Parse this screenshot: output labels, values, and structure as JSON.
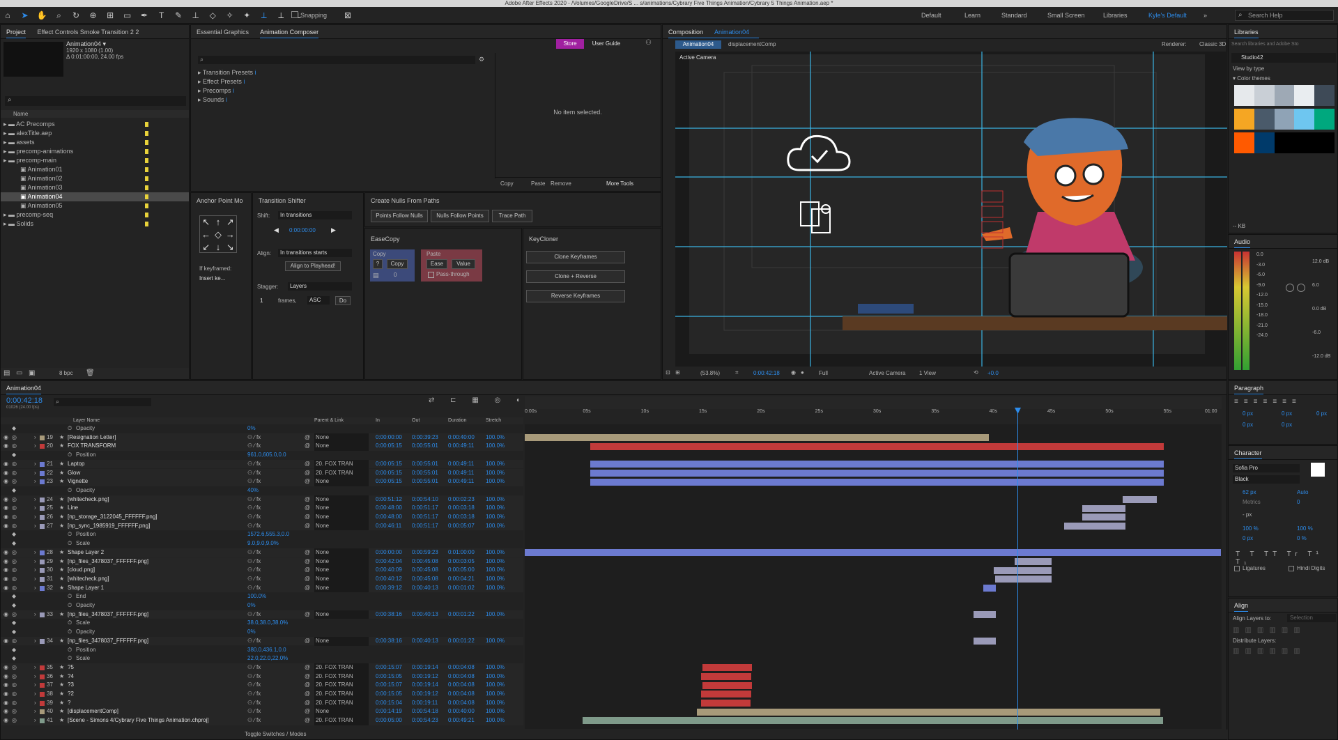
{
  "titlebar": {
    "text": "Adobe After Effects 2020 - /Volumes/GoogleDrive/S ... s/animations/Cybrary Five Things Animation/Cybrary 5 Things Animation.aep *"
  },
  "toolbar": {
    "snapping": "Snapping",
    "workspaces": [
      "Default",
      "Learn",
      "Standard",
      "Small Screen",
      "Libraries",
      "Kyle's Default"
    ],
    "search_help": "Search Help"
  },
  "project": {
    "tabs": [
      "Project",
      "Effect Controls Smoke Transition 2 2"
    ],
    "comp_name": "Animation04 ▾",
    "comp_info": [
      "1920 x 1080 (1.00)",
      "Δ 0:01:00:00, 24.00 fps"
    ],
    "column": "Name",
    "items": [
      "AC Precomps",
      "alexTitle.aep",
      "assets",
      "precomp-animations",
      "precomp-main",
      "Animation01",
      "Animation02",
      "Animation03",
      "Animation04",
      "Animation05",
      "precomp-seq",
      "Solids"
    ],
    "bpc": "8 bpc"
  },
  "composer": {
    "tabs": [
      "Essential Graphics",
      "Animation Composer"
    ],
    "store": "Store",
    "user_guide": "User Guide",
    "tree": [
      "Transition Presets",
      "Effect Presets",
      "Precomps",
      "Sounds"
    ],
    "no_item": "No item selected.",
    "copy": "Copy",
    "paste": "Paste",
    "remove": "Remove",
    "more_tools": "More Tools"
  },
  "anchor": {
    "title": "Anchor Point Mo",
    "if_keyframed": "If keyframed:",
    "insert": "Insert ke..."
  },
  "shifter": {
    "title": "Transition Shifter",
    "shift_label": "Shift:",
    "shift_value": "In transitions",
    "time": "0:00:00:00",
    "align_label": "Align:",
    "align_value": "In transitions starts",
    "align_btn": "Align to Playhead!",
    "stagger_label": "Stagger:",
    "stagger_value": "Layers",
    "frames_num": "1",
    "frames": "frames,",
    "asc": "ASC",
    "do": "Do"
  },
  "nulls": {
    "title": "Create Nulls From Paths",
    "buttons": [
      "Points Follow Nulls",
      "Nulls Follow Points",
      "Trace Path"
    ]
  },
  "easecopy": {
    "title": "EaseCopy",
    "copy_label": "Copy",
    "copy_btn": "Copy",
    "copy_num": "0",
    "paste_label": "Paste",
    "ease": "Ease",
    "value": "Value",
    "passthrough": "Pass-through"
  },
  "keycloner": {
    "title": "KeyCloner",
    "buttons": [
      "Clone Keyframes",
      "Clone + Reverse",
      "Reverse Keyframes"
    ]
  },
  "composition": {
    "tab": "Composition",
    "tab_name": "Animation04",
    "crumbs": [
      "Animation04",
      "displacementComp"
    ],
    "renderer": "Renderer:",
    "renderer_val": "Classic 3D",
    "camera": "Active Camera",
    "footer": {
      "zoom": "(53.8%)",
      "time": "0:00:42:18",
      "res": "Full",
      "view": "Active Camera",
      "views": "1 View",
      "exposure": "+0.0"
    }
  },
  "libraries": {
    "title": "Libraries",
    "search": "Search libraries and Adobe Sto",
    "lib": "Studio42",
    "view_by": "View by type",
    "color_themes": "Color themes",
    "size": "-- KB",
    "swatches": [
      [
        "#e6e9ec",
        "#c9cfd6",
        "#9ea9b5",
        "#e9edf0",
        "#3e4a57"
      ],
      [
        "#f5a623",
        "#4a5a6a",
        "#8fa3b6",
        "#6ec6f0",
        "#00a87e"
      ],
      [
        "#ff5a00",
        "#003a6a",
        "#000000",
        "#000000",
        "#000000"
      ]
    ]
  },
  "audio": {
    "title": "Audio",
    "left": [
      "0.0",
      "-3.0",
      "-6.0",
      "-9.0",
      "-12.0",
      "-15.0",
      "-18.0",
      "-21.0",
      "-24.0"
    ],
    "right": [
      "12.0 dB",
      "6.0",
      "0.0 dB",
      "-6.0",
      "-12.0 dB"
    ]
  },
  "paragraph": {
    "title": "Paragraph",
    "vals": [
      "0 px",
      "0 px",
      "0 px",
      "0 px",
      "0 px"
    ]
  },
  "character": {
    "title": "Character",
    "font": "Sofia Pro",
    "style": "Black",
    "size": "62 px",
    "leading": "Auto",
    "kerning": "Metrics",
    "tracking": "0",
    "stroke": "- px",
    "vscale": "100 %",
    "hscale": "100 %",
    "baseline": "0 px",
    "tsume": "0 %",
    "ligatures": "Ligatures",
    "hindi": "Hindi Digits"
  },
  "align": {
    "title": "Align",
    "align_to": "Align Layers to:",
    "selection": "Selection",
    "distribute": "Distribute Layers:"
  },
  "timeline": {
    "tab": "Animation04",
    "time": "0:00:42:18",
    "frames_info": "01026 (24.00 fps)",
    "headers": {
      "layer": "Layer Name",
      "parent": "Parent & Link",
      "in": "In",
      "out": "Out",
      "duration": "Duration",
      "stretch": "Stretch"
    },
    "ruler": [
      "0:00s",
      "05s",
      "10s",
      "15s",
      "20s",
      "25s",
      "30s",
      "35s",
      "40s",
      "45s",
      "50s",
      "55s",
      "01:00"
    ],
    "toggle": "Toggle Switches / Modes",
    "rows": [
      {
        "type": "prop",
        "name": "Opacity",
        "value": "0%"
      },
      {
        "type": "layer",
        "num": "19",
        "color": "#a89a7a",
        "name": "[Resignation Letter]",
        "parent": "None",
        "in": "0:00:00:00",
        "out": "0:00:39:23",
        "dur": "0:00:40:00",
        "str": "100.0%"
      },
      {
        "type": "layer",
        "num": "20",
        "color": "#c23a3a",
        "name": "FOX TRANSFORM",
        "parent": "None",
        "in": "0:00:05:15",
        "out": "0:00:55:01",
        "dur": "0:00:49:11",
        "str": "100.0%"
      },
      {
        "type": "prop",
        "name": "Position",
        "value": "961.0,605.0,0.0"
      },
      {
        "type": "layer",
        "num": "21",
        "color": "#6c7ad0",
        "name": "Laptop",
        "parent": "20. FOX TRAN",
        "in": "0:00:05:15",
        "out": "0:00:55:01",
        "dur": "0:00:49:11",
        "str": "100.0%"
      },
      {
        "type": "layer",
        "num": "22",
        "color": "#6c7ad0",
        "name": "Glow",
        "parent": "20. FOX TRAN",
        "in": "0:00:05:15",
        "out": "0:00:55:01",
        "dur": "0:00:49:11",
        "str": "100.0%"
      },
      {
        "type": "layer",
        "num": "23",
        "color": "#6c7ad0",
        "name": "Vignette",
        "parent": "None",
        "in": "0:00:05:15",
        "out": "0:00:55:01",
        "dur": "0:00:49:11",
        "str": "100.0%"
      },
      {
        "type": "prop",
        "name": "Opacity",
        "value": "40%"
      },
      {
        "type": "layer",
        "num": "24",
        "color": "#9a9ab8",
        "name": "[whitecheck.png]",
        "parent": "None",
        "in": "0:00:51:12",
        "out": "0:00:54:10",
        "dur": "0:00:02:23",
        "str": "100.0%"
      },
      {
        "type": "layer",
        "num": "25",
        "color": "#9a9ab8",
        "name": "Line",
        "parent": "None",
        "in": "0:00:48:00",
        "out": "0:00:51:17",
        "dur": "0:00:03:18",
        "str": "100.0%"
      },
      {
        "type": "layer",
        "num": "26",
        "color": "#9a9ab8",
        "name": "[np_storage_3122045_FFFFFF.png]",
        "parent": "None",
        "in": "0:00:48:00",
        "out": "0:00:51:17",
        "dur": "0:00:03:18",
        "str": "100.0%"
      },
      {
        "type": "layer",
        "num": "27",
        "color": "#9a9ab8",
        "name": "[np_sync_1985919_FFFFFF.png]",
        "parent": "None",
        "in": "0:00:46:11",
        "out": "0:00:51:17",
        "dur": "0:00:05:07",
        "str": "100.0%"
      },
      {
        "type": "prop",
        "name": "Position",
        "value": "1572.6,555.3,0.0"
      },
      {
        "type": "prop",
        "name": "Scale",
        "value": "9.0,9.0,9.0%"
      },
      {
        "type": "layer",
        "num": "28",
        "color": "#6c7ad0",
        "name": "Shape Layer 2",
        "parent": "None",
        "in": "0:00:00:00",
        "out": "0:00:59:23",
        "dur": "0:01:00:00",
        "str": "100.0%"
      },
      {
        "type": "layer",
        "num": "29",
        "color": "#9a9ab8",
        "name": "[np_files_3478037_FFFFFF.png]",
        "parent": "None",
        "in": "0:00:42:04",
        "out": "0:00:45:08",
        "dur": "0:00:03:05",
        "str": "100.0%"
      },
      {
        "type": "layer",
        "num": "30",
        "color": "#9a9ab8",
        "name": "[cloud.png]",
        "parent": "None",
        "in": "0:00:40:09",
        "out": "0:00:45:08",
        "dur": "0:00:05:00",
        "str": "100.0%"
      },
      {
        "type": "layer",
        "num": "31",
        "color": "#9a9ab8",
        "name": "[whitecheck.png]",
        "parent": "None",
        "in": "0:00:40:12",
        "out": "0:00:45:08",
        "dur": "0:00:04:21",
        "str": "100.0%"
      },
      {
        "type": "layer",
        "num": "32",
        "color": "#6c7ad0",
        "name": "Shape Layer 1",
        "parent": "None",
        "in": "0:00:39:12",
        "out": "0:00:40:13",
        "dur": "0:00:01:02",
        "str": "100.0%"
      },
      {
        "type": "prop",
        "name": "End",
        "value": "100.0%"
      },
      {
        "type": "prop",
        "name": "Opacity",
        "value": "0%"
      },
      {
        "type": "layer",
        "num": "33",
        "color": "#9a9ab8",
        "name": "[np_files_3478037_FFFFFF.png]",
        "parent": "None",
        "in": "0:00:38:16",
        "out": "0:00:40:13",
        "dur": "0:00:01:22",
        "str": "100.0%"
      },
      {
        "type": "prop",
        "name": "Scale",
        "value": "38.0,38.0,38.0%"
      },
      {
        "type": "prop",
        "name": "Opacity",
        "value": "0%"
      },
      {
        "type": "layer",
        "num": "34",
        "color": "#9a9ab8",
        "name": "[np_files_3478037_FFFFFF.png]",
        "parent": "None",
        "in": "0:00:38:16",
        "out": "0:00:40:13",
        "dur": "0:00:01:22",
        "str": "100.0%"
      },
      {
        "type": "prop",
        "name": "Position",
        "value": "380.0,436.1,0.0"
      },
      {
        "type": "prop",
        "name": "Scale",
        "value": "22.0,22.0,22.0%"
      },
      {
        "type": "layer",
        "num": "35",
        "color": "#c23a3a",
        "name": "?5",
        "parent": "20. FOX TRAN",
        "in": "0:00:15:07",
        "out": "0:00:19:14",
        "dur": "0:00:04:08",
        "str": "100.0%"
      },
      {
        "type": "layer",
        "num": "36",
        "color": "#c23a3a",
        "name": "?4",
        "parent": "20. FOX TRAN",
        "in": "0:00:15:05",
        "out": "0:00:19:12",
        "dur": "0:00:04:08",
        "str": "100.0%"
      },
      {
        "type": "layer",
        "num": "37",
        "color": "#c23a3a",
        "name": "?3",
        "parent": "20. FOX TRAN",
        "in": "0:00:15:07",
        "out": "0:00:19:14",
        "dur": "0:00:04:08",
        "str": "100.0%"
      },
      {
        "type": "layer",
        "num": "38",
        "color": "#c23a3a",
        "name": "?2",
        "parent": "20. FOX TRAN",
        "in": "0:00:15:05",
        "out": "0:00:19:12",
        "dur": "0:00:04:08",
        "str": "100.0%"
      },
      {
        "type": "layer",
        "num": "39",
        "color": "#c23a3a",
        "name": "?",
        "parent": "20. FOX TRAN",
        "in": "0:00:15:04",
        "out": "0:00:19:11",
        "dur": "0:00:04:08",
        "str": "100.0%"
      },
      {
        "type": "layer",
        "num": "40",
        "color": "#a89a7a",
        "name": "[displacementComp]",
        "parent": "None",
        "in": "0:00:14:19",
        "out": "0:00:54:18",
        "dur": "0:00:40:00",
        "str": "100.0%"
      },
      {
        "type": "layer",
        "num": "41",
        "color": "#7f9a8a",
        "name": "[Scene - Simons 4/Cybrary Five Things Animation.chproj]",
        "parent": "20. FOX TRAN",
        "in": "0:00:05:00",
        "out": "0:00:54:23",
        "dur": "0:00:49:21",
        "str": "100.0%"
      }
    ]
  }
}
